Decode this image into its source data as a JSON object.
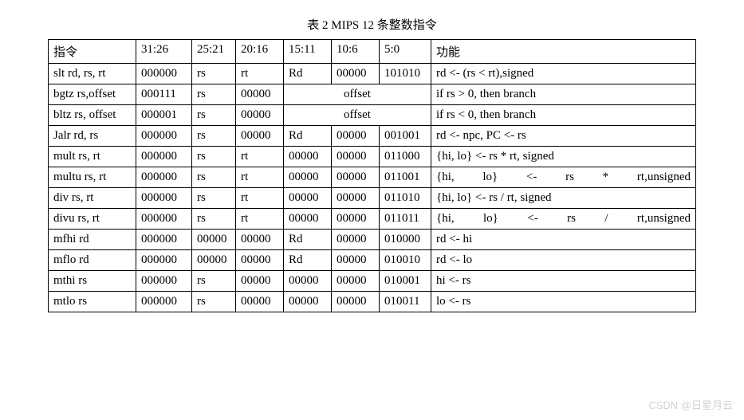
{
  "title": "表 2    MIPS 12 条整数指令",
  "headers": [
    "指令",
    "31:26",
    "25:21",
    "20:16",
    "15:11",
    "10:6",
    "5:0",
    "功能"
  ],
  "rows": [
    {
      "cells": [
        "slt rd, rs, rt",
        "000000",
        "rs",
        "rt",
        "Rd",
        "00000",
        "101010",
        "rd <- (rs < rt),signed"
      ]
    },
    {
      "cells": [
        "bgtz rs,offset",
        "000111",
        "rs",
        "00000",
        {
          "text": "offset",
          "colspan": 3,
          "class": "offset-cell"
        },
        "if rs > 0, then branch"
      ]
    },
    {
      "cells": [
        "bltz rs, offset",
        "000001",
        "rs",
        "00000",
        {
          "text": "offset",
          "colspan": 3,
          "class": "offset-cell"
        },
        "if rs < 0, then branch"
      ]
    },
    {
      "cells": [
        "Jalr rd, rs",
        "000000",
        "rs",
        "00000",
        "Rd",
        "00000",
        "001001",
        "rd <- npc, PC <- rs"
      ]
    },
    {
      "cells": [
        "mult rs, rt",
        "000000",
        "rs",
        "rt",
        "00000",
        "00000",
        "011000",
        "{hi, lo} <- rs * rt, signed"
      ]
    },
    {
      "cells": [
        "multu rs, rt",
        "000000",
        "rs",
        "rt",
        "00000",
        "00000",
        "011001",
        {
          "text": "{hi, lo} <- rs * rt,unsigned",
          "class": "just"
        }
      ]
    },
    {
      "cells": [
        "div rs, rt",
        "000000",
        "rs",
        "rt",
        "00000",
        "00000",
        "011010",
        "{hi, lo} <- rs / rt, signed"
      ]
    },
    {
      "cells": [
        "divu rs, rt",
        "000000",
        "rs",
        "rt",
        "00000",
        "00000",
        "011011",
        {
          "text": "{hi, lo} <- rs / rt,unsigned",
          "class": "just"
        }
      ]
    },
    {
      "cells": [
        "mfhi rd",
        "000000",
        "00000",
        "00000",
        "Rd",
        "00000",
        "010000",
        "rd <- hi"
      ]
    },
    {
      "cells": [
        "mflo rd",
        "000000",
        "00000",
        "00000",
        "Rd",
        "00000",
        "010010",
        "rd <- lo"
      ]
    },
    {
      "cells": [
        "mthi rs",
        "000000",
        "rs",
        "00000",
        "00000",
        "00000",
        "010001",
        "hi <- rs"
      ]
    },
    {
      "cells": [
        "mtlo rs",
        "000000",
        "rs",
        "00000",
        "00000",
        "00000",
        "010011",
        "lo <- rs"
      ]
    }
  ],
  "watermark": "CSDN @日星月云"
}
